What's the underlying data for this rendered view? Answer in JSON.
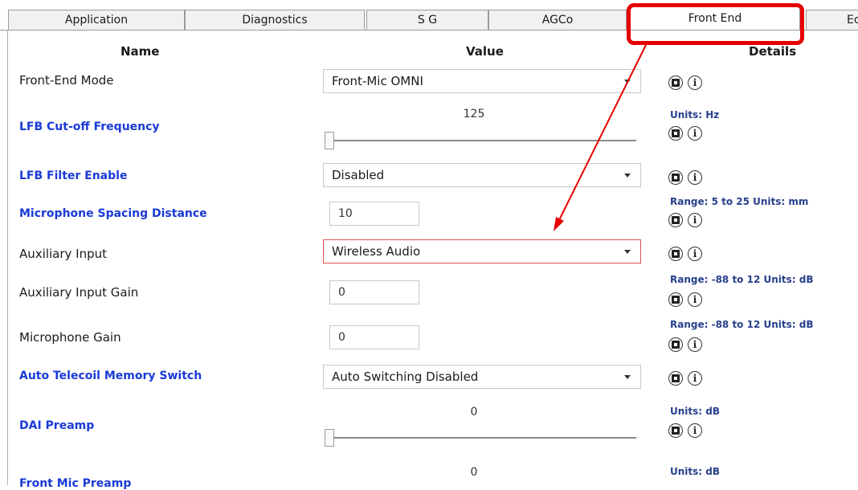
{
  "tabs": [
    {
      "label": "Application"
    },
    {
      "label": "Diagnostics"
    },
    {
      "label": "S G"
    },
    {
      "label": "AGCo"
    },
    {
      "label": "Front End",
      "active": true
    },
    {
      "label": "Ec"
    }
  ],
  "columns": {
    "name": "Name",
    "value": "Value",
    "details": "Details"
  },
  "rows": [
    {
      "label": "Front-End Mode",
      "control": "select",
      "value": "Front-Mic OMNI",
      "details": ""
    },
    {
      "label": "LFB Cut-off Frequency",
      "control": "slider",
      "value": "125",
      "slider_fraction": 0.0,
      "details": "Units: Hz"
    },
    {
      "label": "LFB Filter Enable",
      "control": "select",
      "value": "Disabled",
      "details": ""
    },
    {
      "label": "Microphone Spacing Distance",
      "control": "input",
      "value": "10",
      "details": "Range: 5 to 25 Units: mm"
    },
    {
      "label": "Auxiliary Input",
      "control": "select",
      "value": "Wireless Audio",
      "details": "",
      "highlighted": true
    },
    {
      "label": "Auxiliary Input Gain",
      "control": "input",
      "value": "0",
      "details": "Range: -88 to 12 Units: dB"
    },
    {
      "label": "Microphone Gain",
      "control": "input",
      "value": "0",
      "details": "Range: -88 to 12 Units: dB"
    },
    {
      "label": "Auto Telecoil Memory Switch",
      "control": "select",
      "value": "Auto Switching Disabled",
      "details": ""
    },
    {
      "label": "DAI Preamp",
      "control": "slider",
      "value": "0",
      "slider_fraction": 0.0,
      "details": "Units: dB"
    },
    {
      "label": "Front Mic Preamp",
      "control": "slider",
      "value": "0",
      "slider_fraction": 0.0,
      "details": "Units: dB"
    }
  ],
  "icons": {
    "restore": "restore-default-icon",
    "info": "info-icon",
    "info_glyph": "i"
  },
  "colors": {
    "accent_blue": "#1a3ad6",
    "details_text": "#27408b",
    "highlight_red": "#e60000"
  }
}
